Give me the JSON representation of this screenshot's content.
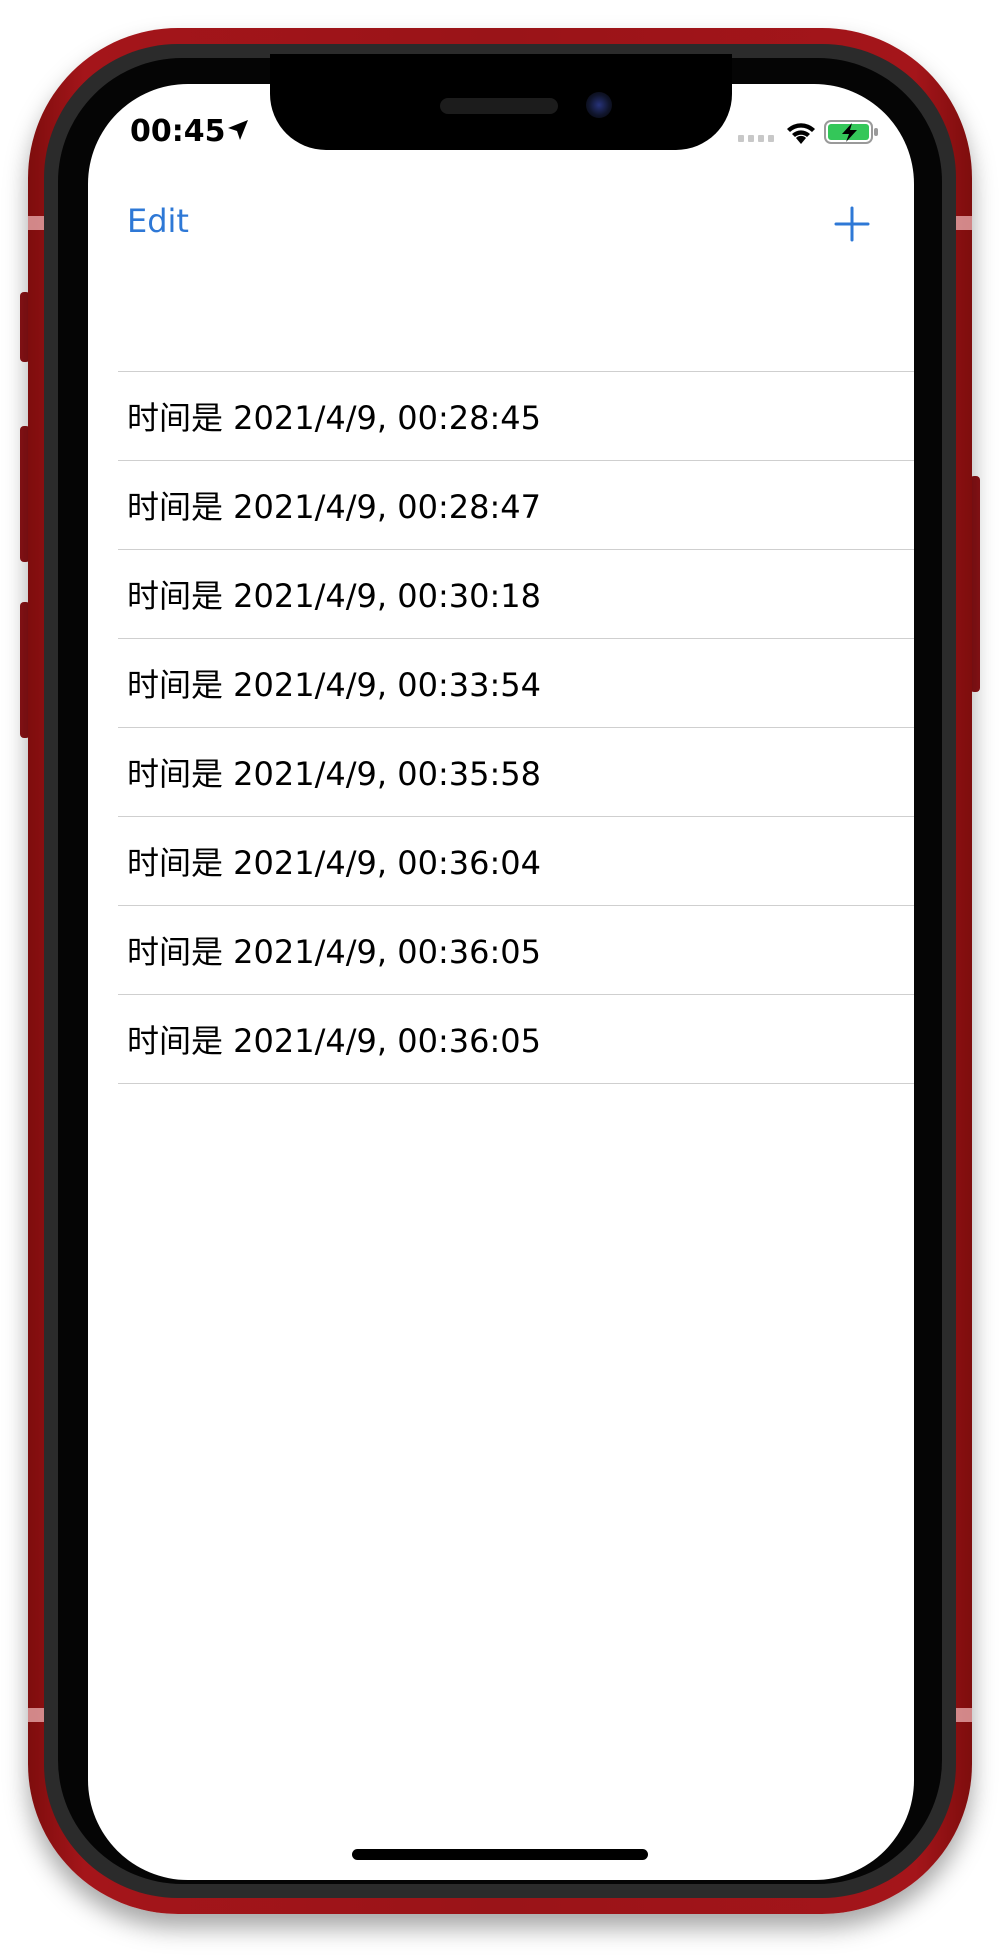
{
  "status_bar": {
    "time": "00:45",
    "icons": [
      "location-arrow-icon",
      "cellular-signal-icon",
      "wifi-icon",
      "battery-charging-icon"
    ],
    "battery_color": "#34c759"
  },
  "nav": {
    "edit_label": "Edit",
    "add_icon": "plus-icon",
    "accent_color": "#2e78d6"
  },
  "list": {
    "items": [
      {
        "label": "时间是 2021/4/9, 00:28:45"
      },
      {
        "label": "时间是 2021/4/9, 00:28:47"
      },
      {
        "label": "时间是 2021/4/9, 00:30:18"
      },
      {
        "label": "时间是 2021/4/9, 00:33:54"
      },
      {
        "label": "时间是 2021/4/9, 00:35:58"
      },
      {
        "label": "时间是 2021/4/9, 00:36:04"
      },
      {
        "label": "时间是 2021/4/9, 00:36:05"
      },
      {
        "label": "时间是 2021/4/9, 00:36:05"
      }
    ]
  },
  "device": {
    "frame_color": "#a4151a"
  }
}
